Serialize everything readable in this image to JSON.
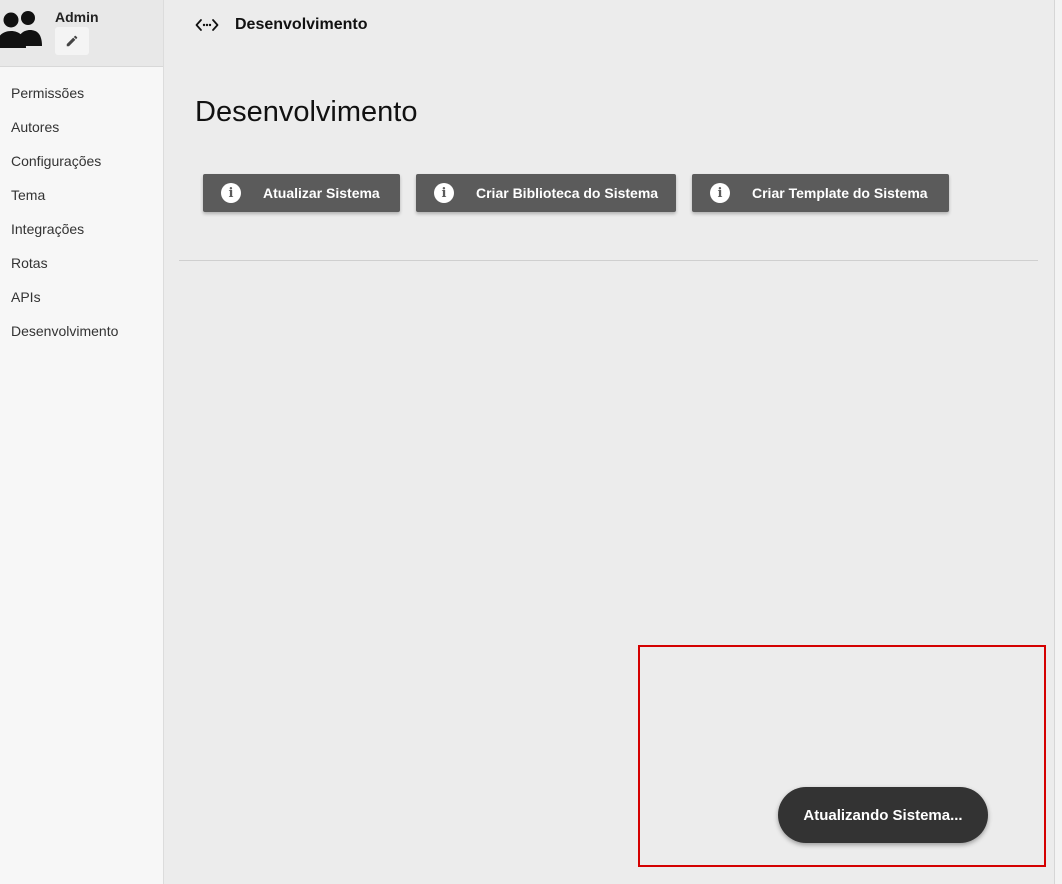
{
  "user": {
    "name": "Admin"
  },
  "sidebar": {
    "items": [
      {
        "label": "Permissões"
      },
      {
        "label": "Autores"
      },
      {
        "label": "Configurações"
      },
      {
        "label": "Tema"
      },
      {
        "label": "Integrações"
      },
      {
        "label": "Rotas"
      },
      {
        "label": "APIs"
      },
      {
        "label": "Desenvolvimento"
      }
    ]
  },
  "header": {
    "breadcrumb": "Desenvolvimento"
  },
  "main": {
    "title": "Desenvolvimento",
    "buttons": [
      {
        "label": "Atualizar Sistema",
        "icon": "info-icon"
      },
      {
        "label": "Criar Biblioteca do Sistema",
        "icon": "info-icon"
      },
      {
        "label": "Criar Template do Sistema",
        "icon": "info-icon"
      }
    ]
  },
  "toast": {
    "message": "Atualizando Sistema..."
  },
  "colors": {
    "button_bg": "#5b5b5b",
    "toast_bg": "#333333",
    "highlight": "#d40000"
  }
}
